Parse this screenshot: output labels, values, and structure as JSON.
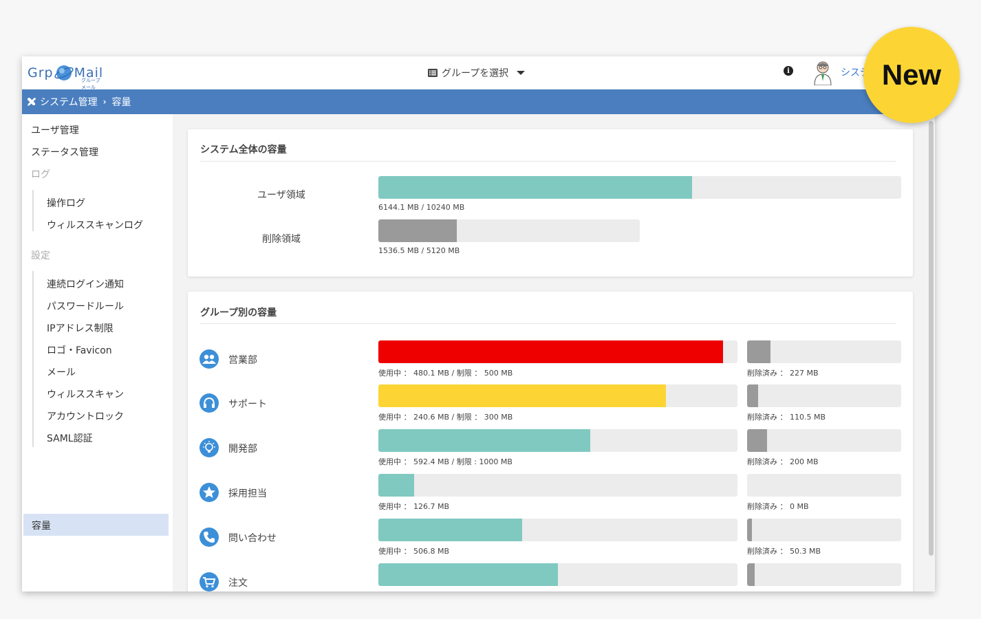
{
  "app": {
    "logo_left": "Grp",
    "logo_right": "Mail",
    "logo_sub": "グループメール",
    "group_select_label": "グループを選択",
    "user_name": "システ"
  },
  "breadcrumb": {
    "root": "システム管理",
    "current": "容量"
  },
  "sidebar": {
    "items": [
      {
        "label": "ユーザ管理"
      },
      {
        "label": "ステータス管理"
      }
    ],
    "log_heading": "ログ",
    "log_items": [
      {
        "label": "操作ログ"
      },
      {
        "label": "ウィルススキャンログ"
      }
    ],
    "settings_heading": "設定",
    "settings_items": [
      {
        "label": "連続ログイン通知"
      },
      {
        "label": "パスワードルール"
      },
      {
        "label": "IPアドレス制限"
      },
      {
        "label": "ロゴ・Favicon"
      },
      {
        "label": "メール"
      },
      {
        "label": "ウィルススキャン"
      },
      {
        "label": "アカウントロック"
      },
      {
        "label": "SAML認証"
      }
    ],
    "active_item": "容量"
  },
  "system_card": {
    "title": "システム全体の容量",
    "rows": [
      {
        "label": "ユーザ領域",
        "used_mb": 6144.1,
        "total_mb": 10240,
        "caption": "6144.1 MB / 10240 MB",
        "color": "#80c9c1"
      },
      {
        "label": "削除領域",
        "used_mb": 1536.5,
        "total_mb": 5120,
        "caption": "1536.5 MB / 5120 MB",
        "color": "#9a9a9a"
      }
    ]
  },
  "group_card": {
    "title": "グループ別の容量",
    "groups": [
      {
        "name": "営業部",
        "icon": "group-people-icon",
        "usage_fraction": 0.96,
        "usage_color": "#ee0000",
        "usage_caption": "使用中 ： 480.1 MB / 制限 ： 500 MB",
        "deleted_fraction": 0.15,
        "deleted_caption": "削除済み ： 227 MB"
      },
      {
        "name": "サポート",
        "icon": "headset-icon",
        "usage_fraction": 0.8,
        "usage_color": "#fcd535",
        "usage_caption": "使用中 ： 240.6 MB / 制限 ： 300 MB",
        "deleted_fraction": 0.07,
        "deleted_caption": "削除済み ： 110.5 MB"
      },
      {
        "name": "開発部",
        "icon": "lightbulb-icon",
        "usage_fraction": 0.59,
        "usage_color": "#80c9c1",
        "usage_caption": "使用中 ： 592.4 MB / 制限 : 1000 MB",
        "deleted_fraction": 0.13,
        "deleted_caption": "削除済み ： 200 MB"
      },
      {
        "name": "採用担当",
        "icon": "star-icon",
        "usage_fraction": 0.1,
        "usage_color": "#80c9c1",
        "usage_caption": "使用中 ： 126.7 MB",
        "deleted_fraction": 0.0,
        "deleted_caption": "削除済み ： 0 MB"
      },
      {
        "name": "問い合わせ",
        "icon": "phone-icon",
        "usage_fraction": 0.4,
        "usage_color": "#80c9c1",
        "usage_caption": "使用中 ： 506.8 MB",
        "deleted_fraction": 0.03,
        "deleted_caption": "削除済み ： 50.3 MB"
      },
      {
        "name": "注文",
        "icon": "cart-icon",
        "usage_fraction": 0.5,
        "usage_color": "#80c9c1",
        "usage_caption": "",
        "deleted_fraction": 0.05,
        "deleted_caption": ""
      }
    ]
  },
  "badge": {
    "label": "New",
    "color": "#fcd535"
  },
  "colors": {
    "header_blue": "#4a7ebf",
    "track": "#ececec",
    "deleted_fill": "#9a9a9a",
    "icon_blue": "#3d8fd8"
  }
}
